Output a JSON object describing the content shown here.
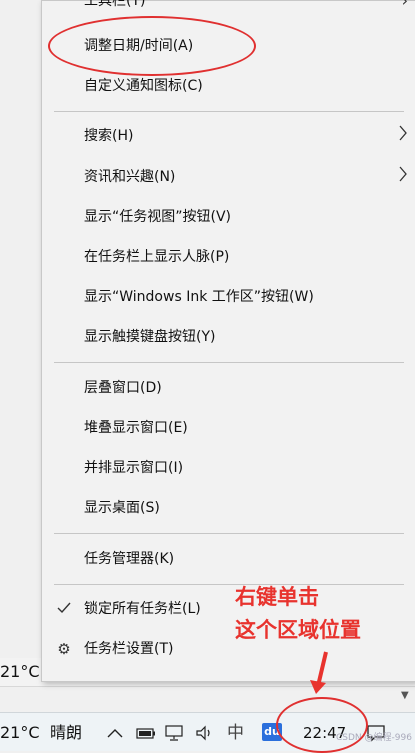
{
  "menu": {
    "partial_item_label": "工具栏(T)",
    "items": [
      {
        "label": "调整日期/时间(A)"
      },
      {
        "label": "自定义通知图标(C)"
      },
      {
        "label": "搜索(H)"
      },
      {
        "label": "资讯和兴趣(N)"
      },
      {
        "label": "显示“任务视图”按钮(V)"
      },
      {
        "label": "在任务栏上显示人脉(P)"
      },
      {
        "label": "显示“Windows Ink 工作区”按钮(W)"
      },
      {
        "label": "显示触摸键盘按钮(Y)"
      },
      {
        "label": "层叠窗口(D)"
      },
      {
        "label": "堆叠显示窗口(E)"
      },
      {
        "label": "并排显示窗口(I)"
      },
      {
        "label": "显示桌面(S)"
      },
      {
        "label": "任务管理器(K)"
      },
      {
        "label": "锁定所有任务栏(L)"
      },
      {
        "label": "任务栏设置(T)"
      }
    ]
  },
  "annotation": {
    "line1": "右键单击",
    "line2": "这个区域位置",
    "color": "#e8332e"
  },
  "taskbar": {
    "temperature": "21°C",
    "weather": "晴朗",
    "ime": "中",
    "du_label": "du",
    "time": "22:47"
  },
  "background_taskbar": {
    "temperature": "21°C"
  },
  "watermark": "CSDN @编程-996"
}
